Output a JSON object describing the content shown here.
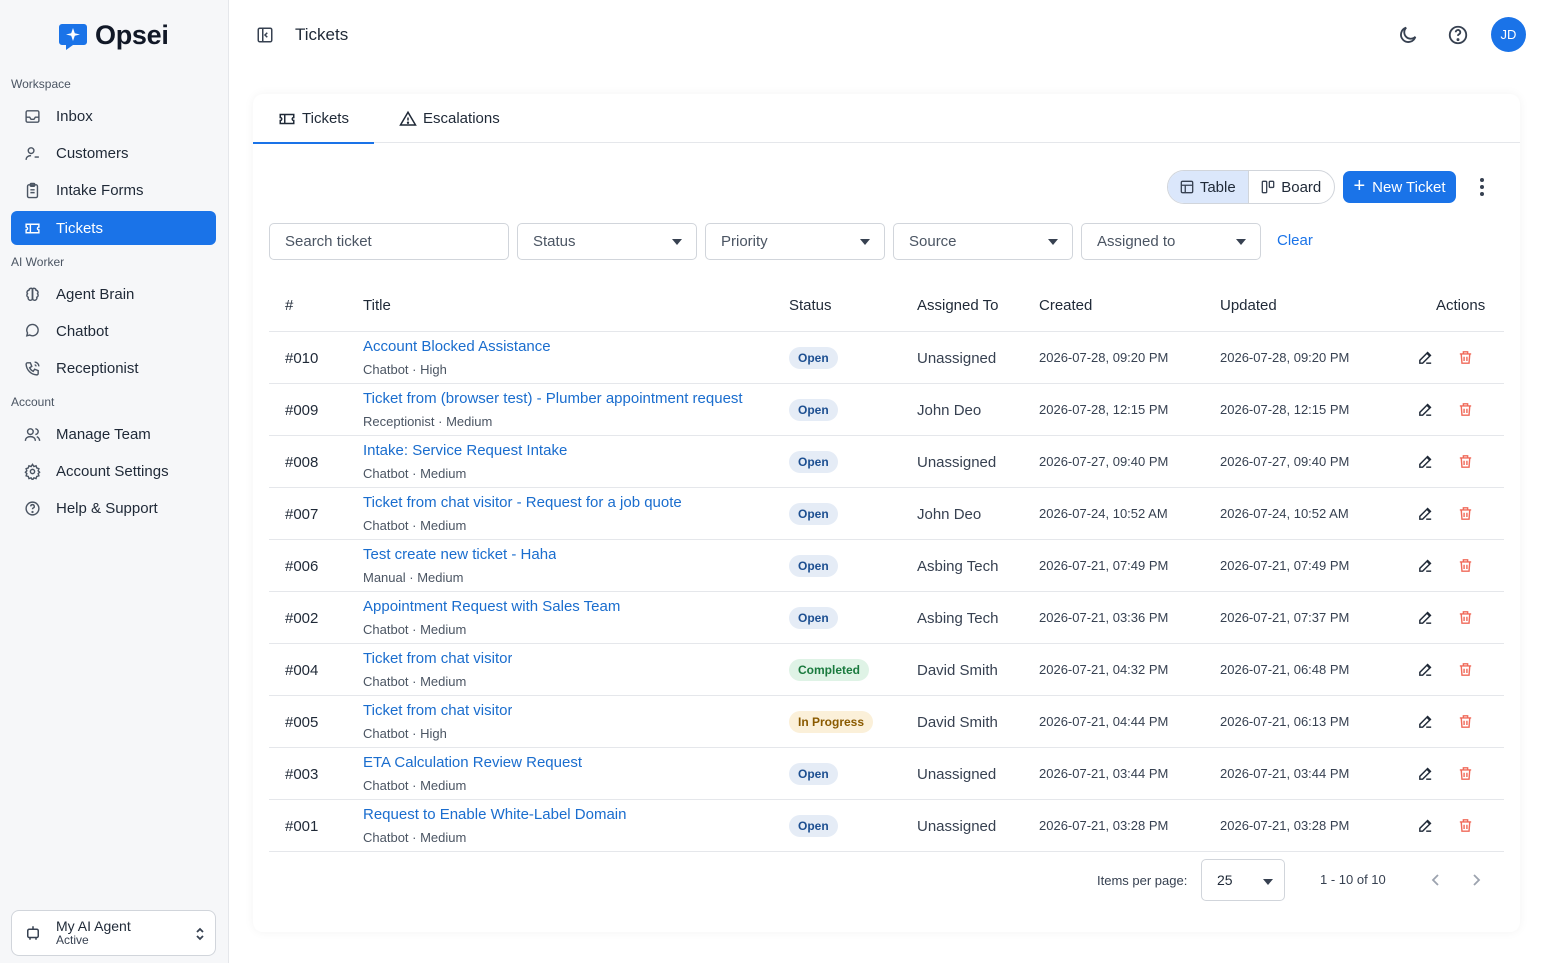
{
  "app": {
    "name": "Opsei"
  },
  "sidebar": {
    "sections": {
      "workspace": "Workspace",
      "ai_worker": "AI Worker",
      "account": "Account"
    },
    "items": [
      {
        "label": "Inbox",
        "icon": "inbox-icon"
      },
      {
        "label": "Customers",
        "icon": "user-icon"
      },
      {
        "label": "Intake Forms",
        "icon": "clipboard-icon"
      },
      {
        "label": "Tickets",
        "icon": "ticket-icon",
        "active": true
      },
      {
        "label": "Agent Brain",
        "icon": "brain-icon"
      },
      {
        "label": "Chatbot",
        "icon": "chat-icon"
      },
      {
        "label": "Receptionist",
        "icon": "phone-icon"
      },
      {
        "label": "Manage Team",
        "icon": "team-icon"
      },
      {
        "label": "Account Settings",
        "icon": "gear-icon"
      },
      {
        "label": "Help & Support",
        "icon": "help-icon"
      }
    ],
    "agent": {
      "name": "My AI Agent",
      "status": "Active"
    }
  },
  "header": {
    "title": "Tickets",
    "avatar_initials": "JD"
  },
  "tabs": [
    {
      "label": "Tickets",
      "icon": "ticket-icon",
      "active": true
    },
    {
      "label": "Escalations",
      "icon": "warning-icon",
      "active": false
    }
  ],
  "toolbar": {
    "view_table": "Table",
    "view_board": "Board",
    "new_ticket": "New Ticket"
  },
  "filters": {
    "search_placeholder": "Search ticket",
    "status": "Status",
    "priority": "Priority",
    "source": "Source",
    "assigned_to": "Assigned to",
    "clear": "Clear"
  },
  "table": {
    "columns": {
      "num": "#",
      "title": "Title",
      "status": "Status",
      "assigned": "Assigned To",
      "created": "Created",
      "updated": "Updated",
      "actions": "Actions"
    },
    "rows": [
      {
        "num": "#010",
        "title": "Account Blocked Assistance",
        "sub": "Chatbot · High",
        "status": "Open",
        "assigned": "Unassigned",
        "created": "2026-07-28, 09:20 PM",
        "updated": "2026-07-28, 09:20 PM"
      },
      {
        "num": "#009",
        "title": "Ticket from (browser test) - Plumber appointment request",
        "sub": "Receptionist · Medium",
        "status": "Open",
        "assigned": "John Deo",
        "created": "2026-07-28, 12:15 PM",
        "updated": "2026-07-28, 12:15 PM"
      },
      {
        "num": "#008",
        "title": "Intake: Service Request Intake",
        "sub": "Chatbot · Medium",
        "status": "Open",
        "assigned": "Unassigned",
        "created": "2026-07-27, 09:40 PM",
        "updated": "2026-07-27, 09:40 PM"
      },
      {
        "num": "#007",
        "title": "Ticket from chat visitor - Request for a job quote",
        "sub": "Chatbot · Medium",
        "status": "Open",
        "assigned": "John Deo",
        "created": "2026-07-24, 10:52 AM",
        "updated": "2026-07-24, 10:52 AM"
      },
      {
        "num": "#006",
        "title": "Test create new ticket - Haha",
        "sub": "Manual · Medium",
        "status": "Open",
        "assigned": "Asbing Tech",
        "created": "2026-07-21, 07:49 PM",
        "updated": "2026-07-21, 07:49 PM"
      },
      {
        "num": "#002",
        "title": "Appointment Request with Sales Team",
        "sub": "Chatbot · Medium",
        "status": "Open",
        "assigned": "Asbing Tech",
        "created": "2026-07-21, 03:36 PM",
        "updated": "2026-07-21, 07:37 PM"
      },
      {
        "num": "#004",
        "title": "Ticket from chat visitor",
        "sub": "Chatbot · Medium",
        "status": "Completed",
        "assigned": "David Smith",
        "created": "2026-07-21, 04:32 PM",
        "updated": "2026-07-21, 06:48 PM"
      },
      {
        "num": "#005",
        "title": "Ticket from chat visitor",
        "sub": "Chatbot · High",
        "status": "In Progress",
        "assigned": "David Smith",
        "created": "2026-07-21, 04:44 PM",
        "updated": "2026-07-21, 06:13 PM"
      },
      {
        "num": "#003",
        "title": "ETA Calculation Review Request",
        "sub": "Chatbot · Medium",
        "status": "Open",
        "assigned": "Unassigned",
        "created": "2026-07-21, 03:44 PM",
        "updated": "2026-07-21, 03:44 PM"
      },
      {
        "num": "#001",
        "title": "Request to Enable White-Label Domain",
        "sub": "Chatbot · Medium",
        "status": "Open",
        "assigned": "Unassigned",
        "created": "2026-07-21, 03:28 PM",
        "updated": "2026-07-21, 03:28 PM"
      }
    ]
  },
  "pagination": {
    "items_per_page_label": "Items per page:",
    "items_per_page": "25",
    "range": "1 - 10 of 10"
  },
  "colors": {
    "accent": "#1a73e8",
    "delete": "#f06a5a",
    "link": "#1a6dce"
  }
}
